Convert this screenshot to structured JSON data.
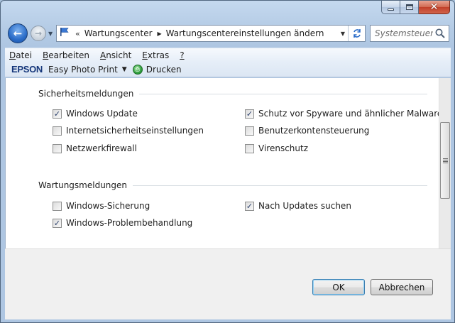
{
  "window": {
    "minimize_glyph": "minimize",
    "maximize_glyph": "maximize",
    "close_glyph": "✕"
  },
  "nav": {
    "back_arrow": "←",
    "forward_arrow": "→",
    "address_chevron": "«",
    "breadcrumbs": [
      "Wartungscenter",
      "Wartungscentereinstellungen ändern"
    ],
    "search_placeholder": "Systemsteuer..."
  },
  "menu": {
    "items": [
      "Datei",
      "Bearbeiten",
      "Ansicht",
      "Extras",
      "?"
    ]
  },
  "epson": {
    "logo": "EPSON",
    "product": "Easy Photo Print",
    "print_label": "Drucken"
  },
  "sections": [
    {
      "title": "Sicherheitsmeldungen",
      "items": [
        {
          "label": "Windows Update",
          "checked": true
        },
        {
          "label": "Schutz vor Spyware und ähnlicher Malware",
          "checked": true
        },
        {
          "label": "Internetsicherheitseinstellungen",
          "checked": false
        },
        {
          "label": "Benutzerkontensteuerung",
          "checked": false
        },
        {
          "label": "Netzwerkfirewall",
          "checked": false
        },
        {
          "label": "Virenschutz",
          "checked": false
        }
      ]
    },
    {
      "title": "Wartungsmeldungen",
      "items": [
        {
          "label": "Windows-Sicherung",
          "checked": false
        },
        {
          "label": "Nach Updates suchen",
          "checked": true
        },
        {
          "label": "Windows-Problembehandlung",
          "checked": true
        }
      ]
    }
  ],
  "buttons": {
    "ok": "OK",
    "cancel": "Abbrechen"
  },
  "colors": {
    "title_frame": "#b4cbe5",
    "epson_blue": "#15367a",
    "default_button_border": "#3c7fb1"
  }
}
